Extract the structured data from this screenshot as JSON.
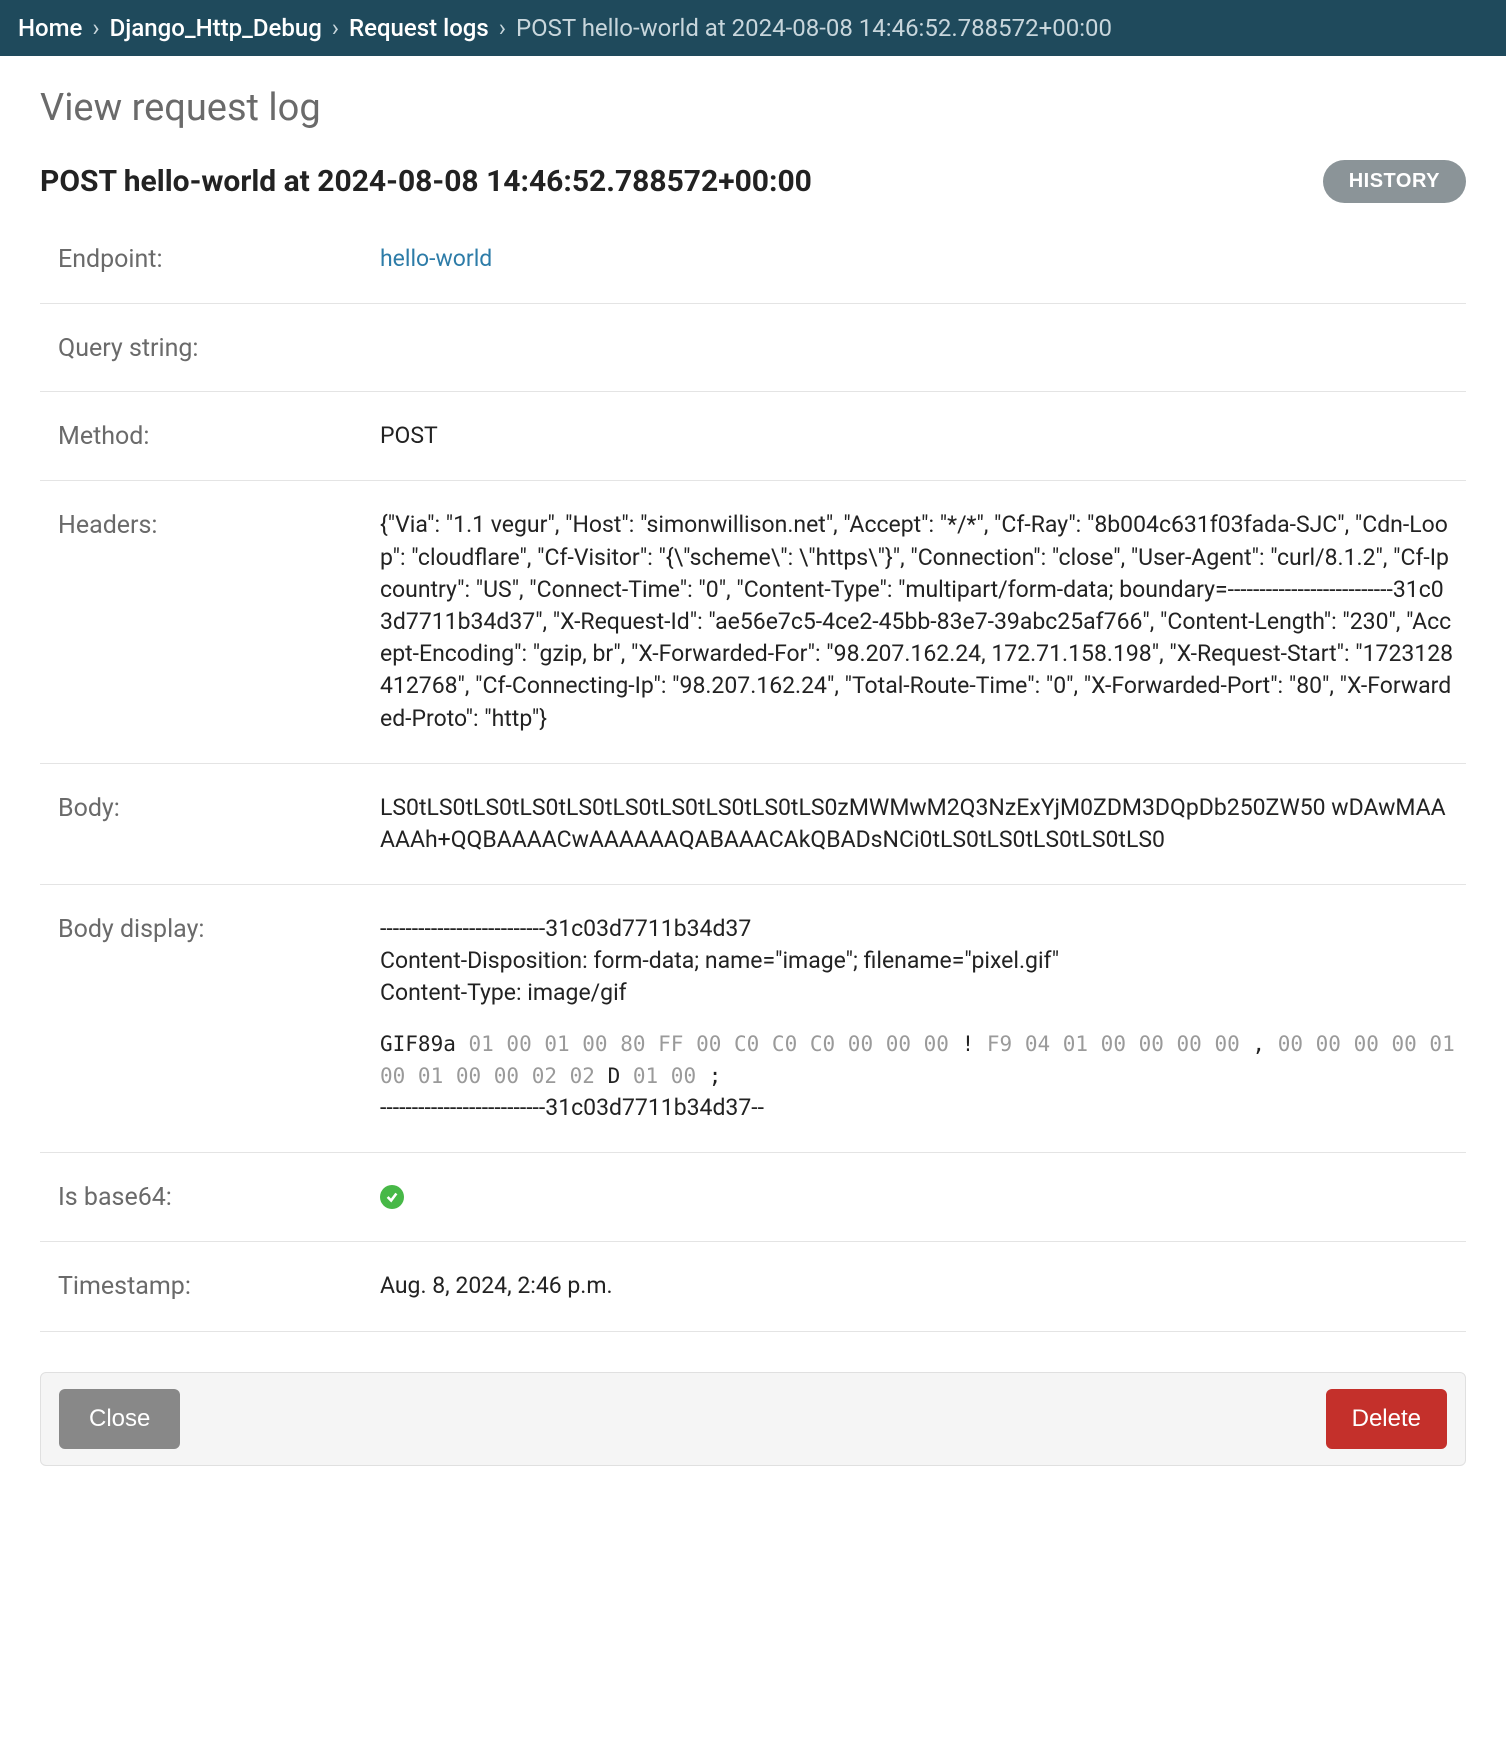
{
  "breadcrumb": {
    "home": "Home",
    "app": "Django_Http_Debug",
    "model": "Request logs",
    "current": "POST hello-world at 2024-08-08 14:46:52.788572+00:00"
  },
  "page_title": "View request log",
  "object_title": "POST hello-world at 2024-08-08 14:46:52.788572+00:00",
  "history_button": "HISTORY",
  "labels": {
    "endpoint": "Endpoint:",
    "query_string": "Query string:",
    "method": "Method:",
    "headers": "Headers:",
    "body": "Body:",
    "body_display": "Body display:",
    "is_base64": "Is base64:",
    "timestamp": "Timestamp:"
  },
  "values": {
    "endpoint_link": "hello-world",
    "query_string": "",
    "method": "POST",
    "headers": "{\"Via\": \"1.1 vegur\", \"Host\": \"simonwillison.net\", \"Accept\": \"*/*\", \"Cf-Ray\": \"8b004c631f03fada-SJC\", \"Cdn-Loop\": \"cloudflare\", \"Cf-Visitor\": \"{\\\"scheme\\\": \\\"https\\\"}\", \"Connection\": \"close\", \"User-Agent\": \"curl/8.1.2\", \"Cf-Ipcountry\": \"US\", \"Connect-Time\": \"0\", \"Content-Type\": \"multipart/form-data; boundary=--------------------------31c03d7711b34d37\", \"X-Request-Id\": \"ae56e7c5-4ce2-45bb-83e7-39abc25af766\", \"Content-Length\": \"230\", \"Accept-Encoding\": \"gzip, br\", \"X-Forwarded-For\": \"98.207.162.24, 172.71.158.198\", \"X-Request-Start\": \"1723128412768\", \"Cf-Connecting-Ip\": \"98.207.162.24\", \"Total-Route-Time\": \"0\", \"X-Forwarded-Port\": \"80\", \"X-Forwarded-Proto\": \"http\"}",
    "body": "LS0tLS0tLS0tLS0tLS0tLS0tLS0tLS0tLS0tLS0zMWMwM2Q3NzExYjM0ZDM3DQpDb250ZW50 wDAwMAAAAAh+QQBAAAACwAAAAAAQABAAACAkQBADsNCi0tLS0tLS0tLS0tLS0tLS0",
    "body_display": {
      "boundary_open": "--------------------------31c03d7711b34d37",
      "content_disposition": "Content-Disposition: form-data; name=\"image\"; filename=\"pixel.gif\"",
      "content_type": "Content-Type: image/gif",
      "gif_tag": "GIF89a",
      "hex1": " 01 00 01 00 80 FF 00 C0 C0 C0 00 00 00 ",
      "bang": "!",
      "hex2": " F9 04 01 00 00 00 00 ",
      "comma": ",",
      "hex3": " 00 00 00 00 01 00 01 00 00 02 02 ",
      "d": "D",
      "hex4": " 01 00 ",
      "semi": ";",
      "boundary_close": "--------------------------31c03d7711b34d37--"
    },
    "timestamp": "Aug. 8, 2024, 2:46 p.m."
  },
  "actions": {
    "close": "Close",
    "delete": "Delete"
  }
}
